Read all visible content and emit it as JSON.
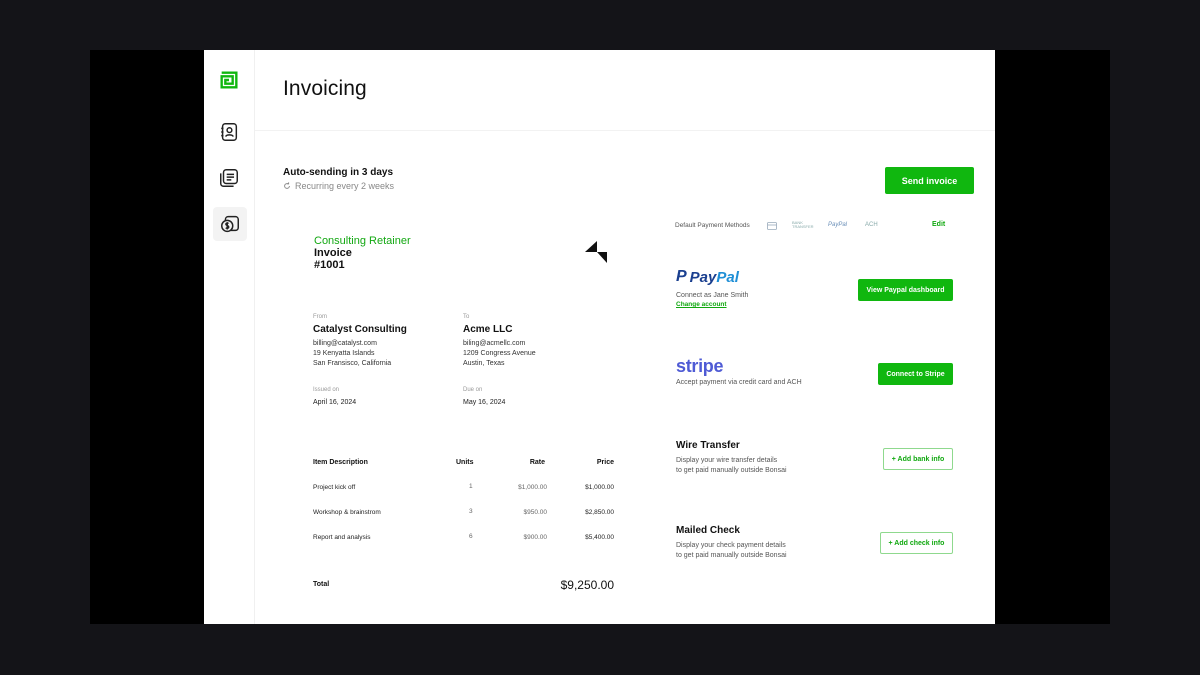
{
  "page": {
    "title": "Invoicing"
  },
  "sidebar": {
    "items": [
      {
        "name": "logo-icon"
      },
      {
        "name": "contacts-icon"
      },
      {
        "name": "documents-icon"
      },
      {
        "name": "invoice-money-icon"
      }
    ]
  },
  "status": {
    "auto_send": "Auto-sending in 3 days",
    "recurring": "Recurring every 2 weeks",
    "send_button": "Send invoice"
  },
  "invoice": {
    "type": "Consulting Retainer",
    "label": "Invoice",
    "number": "#1001",
    "from_label": "From",
    "from_name": "Catalyst Consulting",
    "from_email": "billing@catalyst.com",
    "from_addr1": "19 Kenyatta Islands",
    "from_addr2": "San Fransisco, California",
    "to_label": "To",
    "to_name": "Acme LLC",
    "to_email": "biling@acmellc.com",
    "to_addr1": "1209 Congress Avenue",
    "to_addr2": "Austin, Texas",
    "issued_label": "Issued on",
    "issued_date": "April 16, 2024",
    "due_label": "Due on",
    "due_date": "May 16, 2024",
    "columns": {
      "desc": "Item Description",
      "units": "Units",
      "rate": "Rate",
      "price": "Price"
    },
    "items": [
      {
        "desc": "Project kick off",
        "units": "1",
        "rate": "$1,000.00",
        "price": "$1,000.00"
      },
      {
        "desc": "Workshop & brainstrom",
        "units": "3",
        "rate": "$950.00",
        "price": "$2,850.00"
      },
      {
        "desc": "Report and analysis",
        "units": "6",
        "rate": "$900.00",
        "price": "$5,400.00"
      }
    ],
    "total_label": "Total",
    "total_value": "$9,250.00"
  },
  "payments": {
    "default_label": "Default Payment Methods",
    "icons": [
      "card",
      "BANK TRANSFER",
      "PayPal",
      "ACH"
    ],
    "edit": "Edit",
    "paypal": {
      "logo_p": "P",
      "logo_pay": "Pay",
      "logo_pal": "Pal",
      "desc": "Connect as Jane Smith",
      "link": "Change account",
      "button": "View Paypal dashboard"
    },
    "stripe": {
      "logo": "stripe",
      "desc": "Accept payment via credit card and ACH",
      "button": "Connect to Stripe"
    },
    "wire": {
      "title": "Wire Transfer",
      "desc1": "Display your wire transfer details",
      "desc2": "to get paid manually outside Bonsai",
      "button": "+ Add bank info"
    },
    "check": {
      "title": "Mailed Check",
      "desc1": "Display your check payment details",
      "desc2": "to get paid manually outside Bonsai",
      "button": "+ Add check info"
    }
  },
  "colors": {
    "accent": "#10b70f",
    "paypal_dark": "#1a3f8f",
    "paypal_light": "#1f8fd6",
    "stripe": "#4f5bd5"
  }
}
